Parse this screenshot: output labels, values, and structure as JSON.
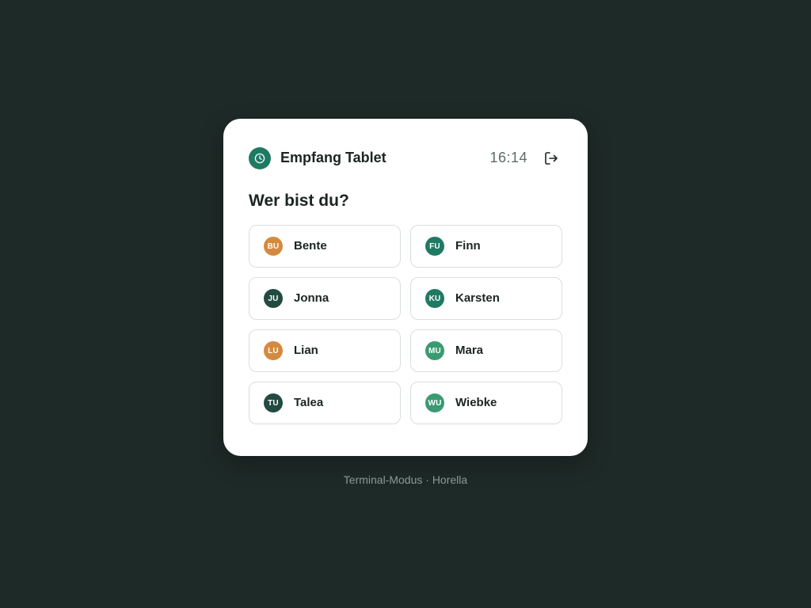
{
  "header": {
    "terminal_name": "Empfang Tablet",
    "time": "16:14",
    "brand_icon": "clock-icon",
    "logout_icon": "logout-icon"
  },
  "prompt": "Wer bist du?",
  "colors": {
    "background": "#1e2a27",
    "card": "#ffffff",
    "accent": "#1f7a63",
    "avatar_orange": "#d48a3e",
    "avatar_dark": "#234a40",
    "avatar_teal": "#1f7a63",
    "avatar_green": "#3a9a72"
  },
  "people": [
    {
      "initials": "BU",
      "name": "Bente",
      "color": "#d48a3e"
    },
    {
      "initials": "FU",
      "name": "Finn",
      "color": "#1f7a63"
    },
    {
      "initials": "JU",
      "name": "Jonna",
      "color": "#234a40"
    },
    {
      "initials": "KU",
      "name": "Karsten",
      "color": "#1f7a63"
    },
    {
      "initials": "LU",
      "name": "Lian",
      "color": "#d48a3e"
    },
    {
      "initials": "MU",
      "name": "Mara",
      "color": "#3a9a72"
    },
    {
      "initials": "TU",
      "name": "Talea",
      "color": "#234a40"
    },
    {
      "initials": "WU",
      "name": "Wiebke",
      "color": "#3a9a72"
    }
  ],
  "footer": {
    "text": "Terminal-Modus · Horella"
  }
}
